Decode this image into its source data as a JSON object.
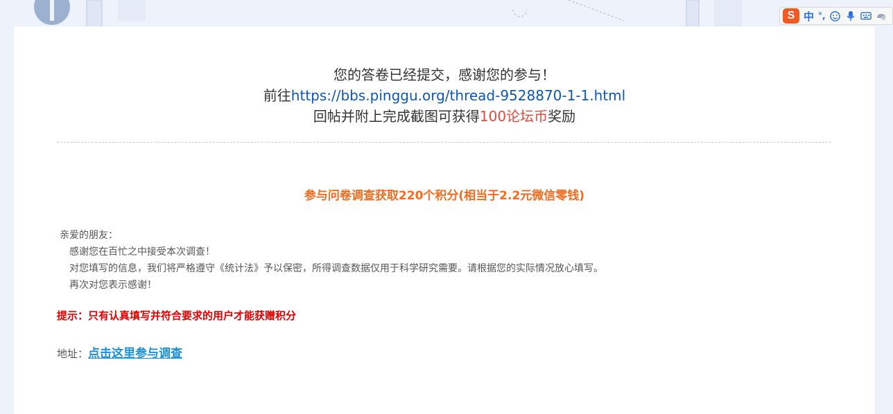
{
  "headline": {
    "line1": "您的答卷已经提交，感谢您的参与！",
    "line2_prefix": "前往",
    "line2_link": "https://bbs.pinggu.org/thread-9528870-1-1.html",
    "line3_prefix": "回帖并附上完成截图可获得",
    "line3_highlight": "100论坛币",
    "line3_suffix": "奖励"
  },
  "points_banner": "参与问卷调查获取220个积分(相当于2.2元微信零钱)",
  "letter": {
    "greeting": "亲爱的朋友：",
    "line1": "感谢您在百忙之中接受本次调查！",
    "line2": "对您填写的信息，我们将严格遵守《统计法》予以保密，所得调查数据仅用于科学研究需要。请根据您的实际情况放心填写。",
    "line3": "再次对您表示感谢！"
  },
  "tip": "提示：只有认真填写并符合要求的用户才能获赠积分",
  "address": {
    "label": "地址：",
    "link": "点击这里参与调查"
  },
  "ime_bar": {
    "logo": "S",
    "mode": "中",
    "punct": "°,",
    "icons": [
      "smiley-icon",
      "microphone-icon",
      "keyboard-icon",
      "skin-icon"
    ]
  },
  "colors": {
    "link_blue": "#0b57b8",
    "reward_red": "#e8473f",
    "points_orange": "#f26b1d",
    "tip_red": "#e00000",
    "address_link": "#1a8fd8"
  }
}
